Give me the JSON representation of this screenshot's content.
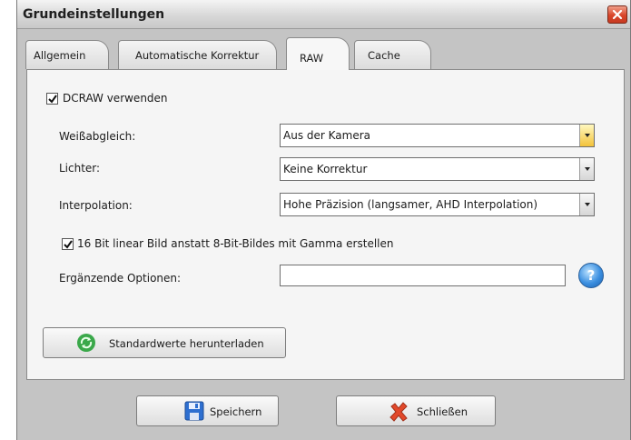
{
  "window": {
    "title": "Grundeinstellungen"
  },
  "tabs": [
    {
      "label": "Allgemein",
      "active": false
    },
    {
      "label": "Automatische Korrektur",
      "active": false
    },
    {
      "label": "RAW",
      "active": true
    },
    {
      "label": "Cache",
      "active": false
    }
  ],
  "raw": {
    "use_dcraw": {
      "label": "DCRAW verwenden",
      "checked": true
    },
    "white_balance": {
      "label": "Weißabgleich:",
      "value": "Aus der Kamera"
    },
    "highlights": {
      "label": "Lichter:",
      "value": "Keine Korrektur"
    },
    "interpolation": {
      "label": "Interpolation:",
      "value": "Hohe Präzision (langsamer, AHD Interpolation)"
    },
    "bit16": {
      "label": "16 Bit linear Bild anstatt 8-Bit-Bildes mit  Gamma erstellen",
      "checked": true
    },
    "extra_options": {
      "label": "Ergänzende Optionen:",
      "value": ""
    },
    "defaults_button": "Standardwerte herunterladen"
  },
  "footer": {
    "save_button": "Speichern",
    "close_button": "Schließen"
  },
  "colors": {
    "window_bg": "#c4c4c4",
    "panel_bg": "#f5f5f5",
    "close_red": "#d9452a",
    "combo_yellow": "#f3c23a",
    "help_blue": "#3b8fe0"
  },
  "icons": {
    "close": "close-x-icon",
    "help": "question-circle-icon",
    "defaults": "recycle-arrows-icon",
    "save": "floppy-disk-icon",
    "close_button": "red-x-icon",
    "dropdown": "chevron-down-icon"
  }
}
